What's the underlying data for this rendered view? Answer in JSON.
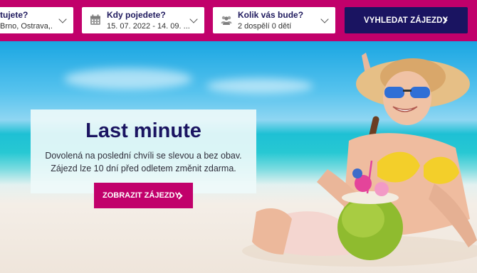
{
  "search": {
    "destination": {
      "label": "tujete?",
      "value": "Brno, Ostrava,..."
    },
    "dates": {
      "label": "Kdy pojedete?",
      "value": "15. 07. 2022 - 14. 09. ..."
    },
    "travelers": {
      "label": "Kolik vás bude?",
      "value": "2 dospělí 0 dětí"
    },
    "submit_label": "VYHLEDAT ZÁJEZDY"
  },
  "hero": {
    "title": "Last minute",
    "line1": "Dovolená na poslední chvíli se slevou a bez obav.",
    "line2": "Zájezd lze 10 dní před odletem změnit zdarma.",
    "cta_label": "ZOBRAZIT ZÁJEZDY",
    "image": "beach-woman-coconut"
  },
  "colors": {
    "brand_magenta": "#c1006b",
    "brand_navy": "#1a1461"
  }
}
